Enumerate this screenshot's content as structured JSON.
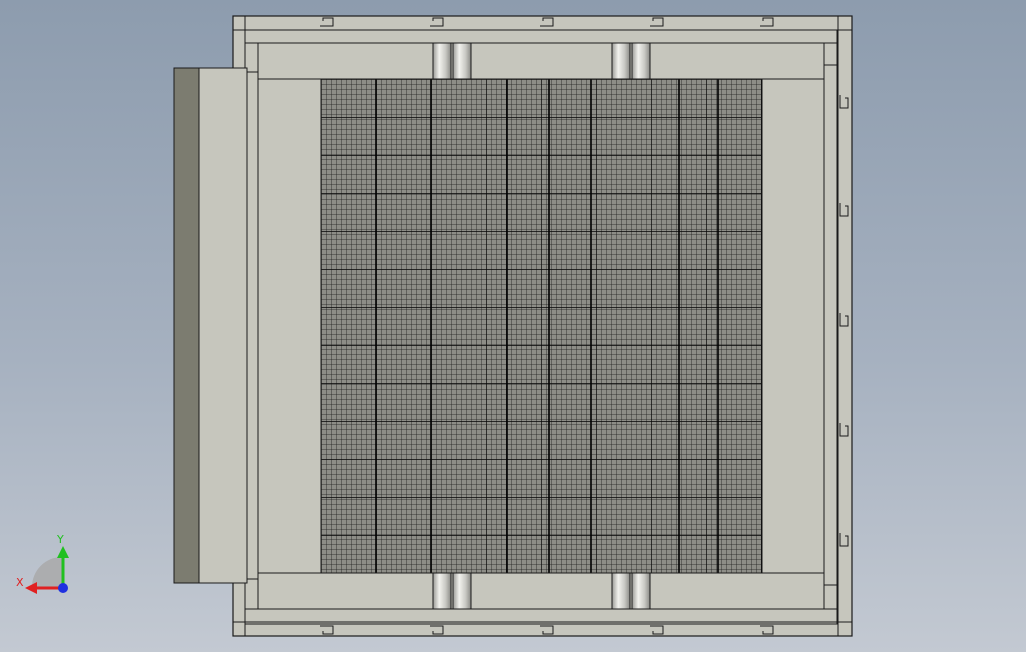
{
  "viewport": {
    "view": "top-view",
    "background_top": "#8d9cae",
    "background_bottom": "#c3c9d2"
  },
  "model": {
    "panel_fill": "#c6c6bd",
    "panel_stroke": "#1a1a1a",
    "side_block_dark": "#7c7c70",
    "mesh_fill": "#8d8d87",
    "mesh_line": "#101010"
  },
  "triad": {
    "x_label": "X",
    "y_label": "Y",
    "x_color": "#e02020",
    "y_color": "#20c020",
    "z_color": "#2030e0"
  }
}
